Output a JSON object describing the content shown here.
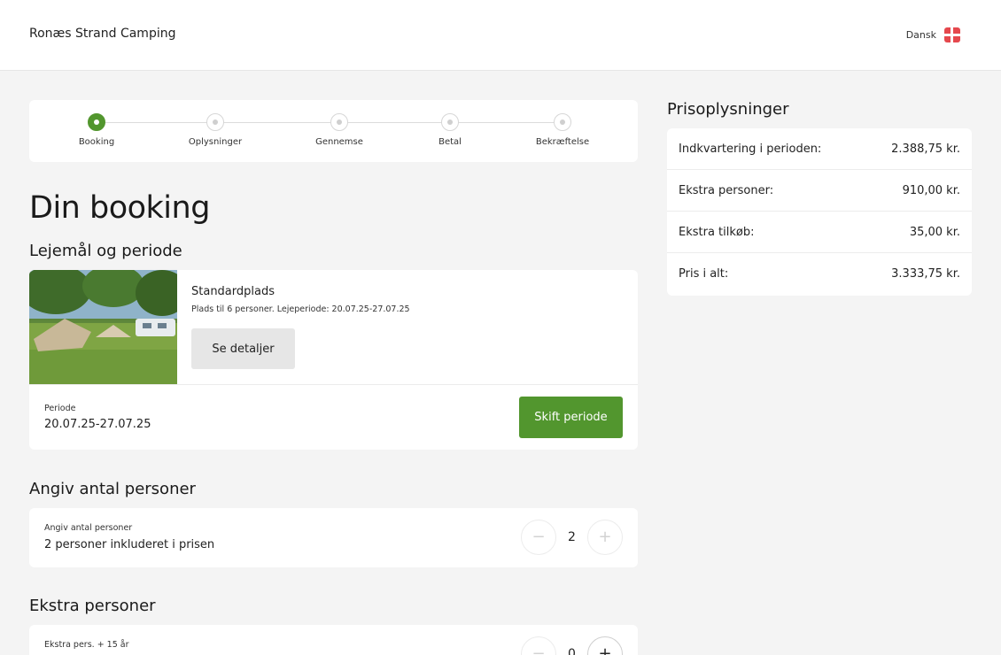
{
  "header": {
    "brand": "Ronæs Strand Camping",
    "language": "Dansk"
  },
  "stepper": {
    "steps": [
      {
        "label": "Booking",
        "active": true
      },
      {
        "label": "Oplysninger",
        "active": false
      },
      {
        "label": "Gennemse",
        "active": false
      },
      {
        "label": "Betal",
        "active": false
      },
      {
        "label": "Bekræftelse",
        "active": false
      }
    ]
  },
  "main": {
    "title": "Din booking",
    "rental_section_title": "Lejemål og periode",
    "rental": {
      "name": "Standardplads",
      "description": "Plads til 6 personer. Lejeperiode: 20.07.25-27.07.25",
      "details_button": "Se detaljer",
      "period_label": "Periode",
      "period_value": "20.07.25-27.07.25",
      "change_period_button": "Skift periode"
    },
    "persons_section_title": "Angiv antal personer",
    "persons": {
      "label": "Angiv antal personer",
      "value": "2 personer inkluderet i prisen",
      "minus": "−",
      "plus": "+",
      "count": "2"
    },
    "extra_section_title": "Ekstra personer",
    "extra": {
      "label": "Ekstra pers. + 15 år",
      "minus": "−",
      "plus": "+",
      "count": "0"
    }
  },
  "prices": {
    "title": "Prisoplysninger",
    "rows": [
      {
        "label": "Indkvartering i perioden:",
        "value": "2.388,75 kr."
      },
      {
        "label": "Ekstra personer:",
        "value": "910,00 kr."
      },
      {
        "label": "Ekstra tilkøb:",
        "value": "35,00 kr."
      },
      {
        "label": "Pris i alt:",
        "value": "3.333,75 kr."
      }
    ]
  },
  "colors": {
    "accent": "#52962e",
    "flag": "#e5484d"
  }
}
